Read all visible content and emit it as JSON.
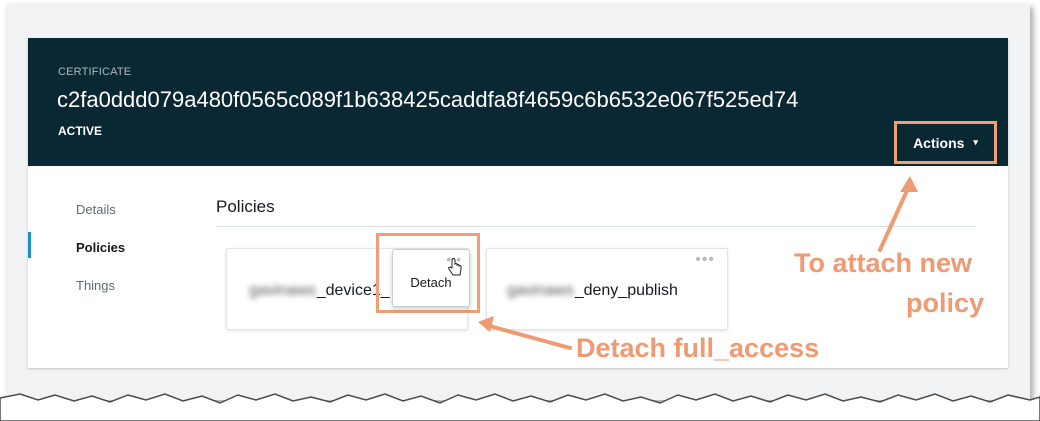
{
  "certificate": {
    "label": "CERTIFICATE",
    "id": "c2fa0ddd079a480f0565c089f1b638425caddfa8f4659c6b6532e067f525ed74",
    "status": "ACTIVE"
  },
  "actions": {
    "label": "Actions",
    "caret": "▾"
  },
  "sidebar": {
    "items": [
      {
        "label": "Details",
        "active": false
      },
      {
        "label": "Policies",
        "active": true
      },
      {
        "label": "Things",
        "active": false
      }
    ]
  },
  "policies": {
    "title": "Policies",
    "cards": [
      {
        "name_prefix": "gavinaws",
        "name_suffix": "_device1_"
      },
      {
        "name_prefix": "gavinaws",
        "name_suffix": "_deny_publish"
      }
    ],
    "menu_icon": "•••"
  },
  "context_menu": {
    "detach_label": "Detach"
  },
  "annotations": {
    "attach_line1": "To attach new",
    "attach_line2": "policy",
    "detach": "Detach full_access"
  },
  "colors": {
    "header_bg": "#0a2833",
    "annotation": "#ee9a72",
    "active_indicator": "#1a8fc7"
  }
}
